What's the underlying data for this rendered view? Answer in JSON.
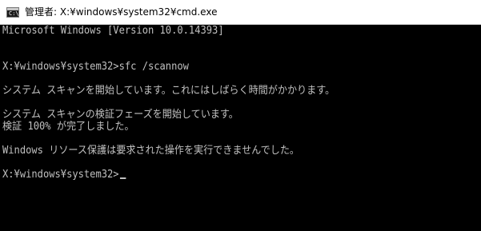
{
  "window": {
    "title": "管理者: X:¥windows¥system32¥cmd.exe",
    "icon": "cmd-icon",
    "icon_glyph": "C:\\"
  },
  "console": {
    "lines": [
      "Microsoft Windows [Version 10.0.14393]",
      "",
      "",
      "X:¥windows¥system32>sfc /scannow",
      "",
      "システム スキャンを開始しています。これにはしばらく時間がかかります。",
      "",
      "システム スキャンの検証フェーズを開始しています。",
      "検証 100% が完了しました。",
      "",
      "Windows リソース保護は要求された操作を実行できませんでした。",
      "",
      "X:¥windows¥system32>"
    ],
    "text_color": "#c0c0c0",
    "background_color": "#000000"
  }
}
